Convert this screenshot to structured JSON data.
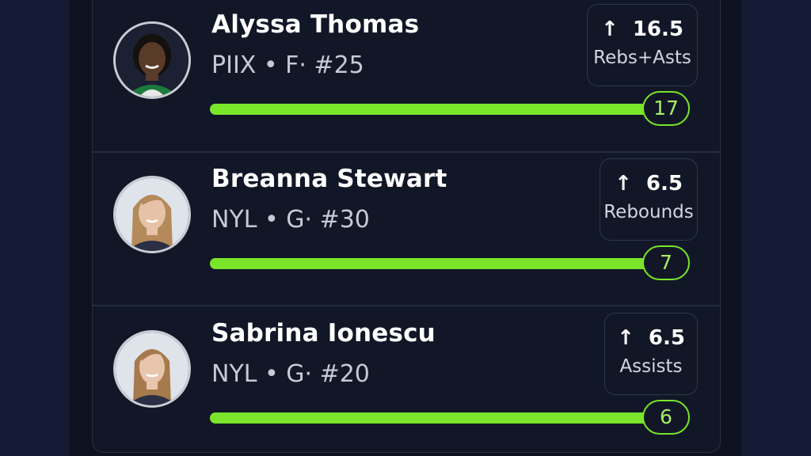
{
  "accent_color": "#7ae52a",
  "players": [
    {
      "name": "Alyssa Thomas",
      "meta": "PIIX • F· #25",
      "line_value": "16.5",
      "line_direction_icon": "arrow-up-icon",
      "stat": "Rebs+Asts",
      "actual": "17",
      "progress_fraction": 1.0,
      "avatar_colors": {
        "skin": "#5a3a28",
        "hair": "#14100e",
        "jersey": "#1e7a3c"
      }
    },
    {
      "name": "Breanna Stewart",
      "meta": "NYL • G· #30",
      "line_value": "6.5",
      "line_direction_icon": "arrow-up-icon",
      "stat": "Rebounds",
      "actual": "7",
      "progress_fraction": 1.0,
      "avatar_colors": {
        "skin": "#e6c2a8",
        "hair": "#b48a5a",
        "jersey": "#2a2f45"
      }
    },
    {
      "name": "Sabrina Ionescu",
      "meta": "NYL • G· #20",
      "line_value": "6.5",
      "line_direction_icon": "arrow-up-icon",
      "stat": "Assists",
      "actual": "6",
      "progress_fraction": 1.0,
      "avatar_colors": {
        "skin": "#e8c6ae",
        "hair": "#a67a4c",
        "jersey": "#2a2f45"
      }
    }
  ]
}
